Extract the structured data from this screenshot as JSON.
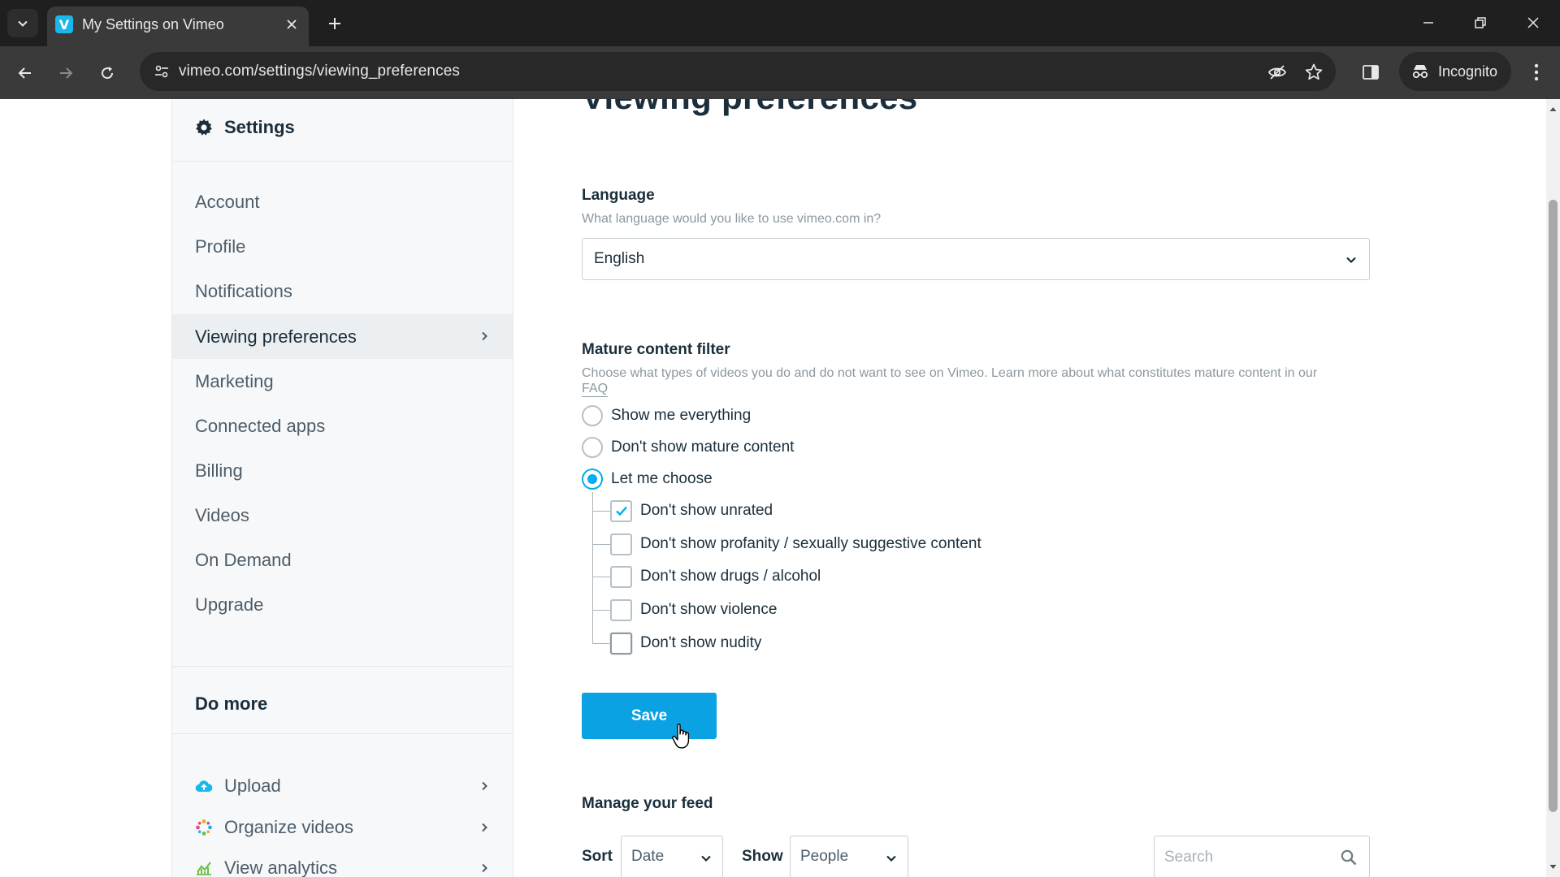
{
  "browser": {
    "tab_title": "My Settings on Vimeo",
    "tab_favicon": "V",
    "url": "vimeo.com/settings/viewing_preferences",
    "incognito_label": "Incognito"
  },
  "sidebar": {
    "title": "Settings",
    "items": [
      {
        "label": "Account"
      },
      {
        "label": "Profile"
      },
      {
        "label": "Notifications"
      },
      {
        "label": "Viewing preferences",
        "active": true
      },
      {
        "label": "Marketing"
      },
      {
        "label": "Connected apps"
      },
      {
        "label": "Billing"
      },
      {
        "label": "Videos"
      },
      {
        "label": "On Demand"
      },
      {
        "label": "Upgrade"
      }
    ]
  },
  "do_more": {
    "title": "Do more",
    "items": [
      {
        "label": "Upload",
        "icon": "upload-cloud-icon"
      },
      {
        "label": "Organize videos",
        "icon": "organize-icon"
      },
      {
        "label": "View analytics",
        "icon": "analytics-icon"
      }
    ]
  },
  "main": {
    "page_title": "Viewing preferences",
    "language": {
      "label": "Language",
      "help": "What language would you like to use vimeo.com in?",
      "value": "English"
    },
    "mature": {
      "label": "Mature content filter",
      "help": "Choose what types of videos you do and do not want to see on Vimeo. Learn more about what constitutes mature content in our",
      "faq": "FAQ",
      "options": [
        {
          "label": "Show me everything",
          "checked": false
        },
        {
          "label": "Don't show mature content",
          "checked": false
        },
        {
          "label": "Let me choose",
          "checked": true
        }
      ],
      "sub_options": [
        {
          "label": "Don't show unrated",
          "checked": true
        },
        {
          "label": "Don't show profanity / sexually suggestive content",
          "checked": false
        },
        {
          "label": "Don't show drugs / alcohol",
          "checked": false
        },
        {
          "label": "Don't show violence",
          "checked": false
        },
        {
          "label": "Don't show nudity",
          "checked": false
        }
      ]
    },
    "save_label": "Save",
    "feed": {
      "title": "Manage your feed",
      "sort_label": "Sort",
      "sort_value": "Date",
      "show_label": "Show",
      "show_value": "People",
      "search_placeholder": "Search"
    }
  },
  "colors": {
    "accent": "#00adef",
    "save_button": "#0aa2e3",
    "text": "#1a2e3b",
    "muted": "#8b98a0"
  }
}
